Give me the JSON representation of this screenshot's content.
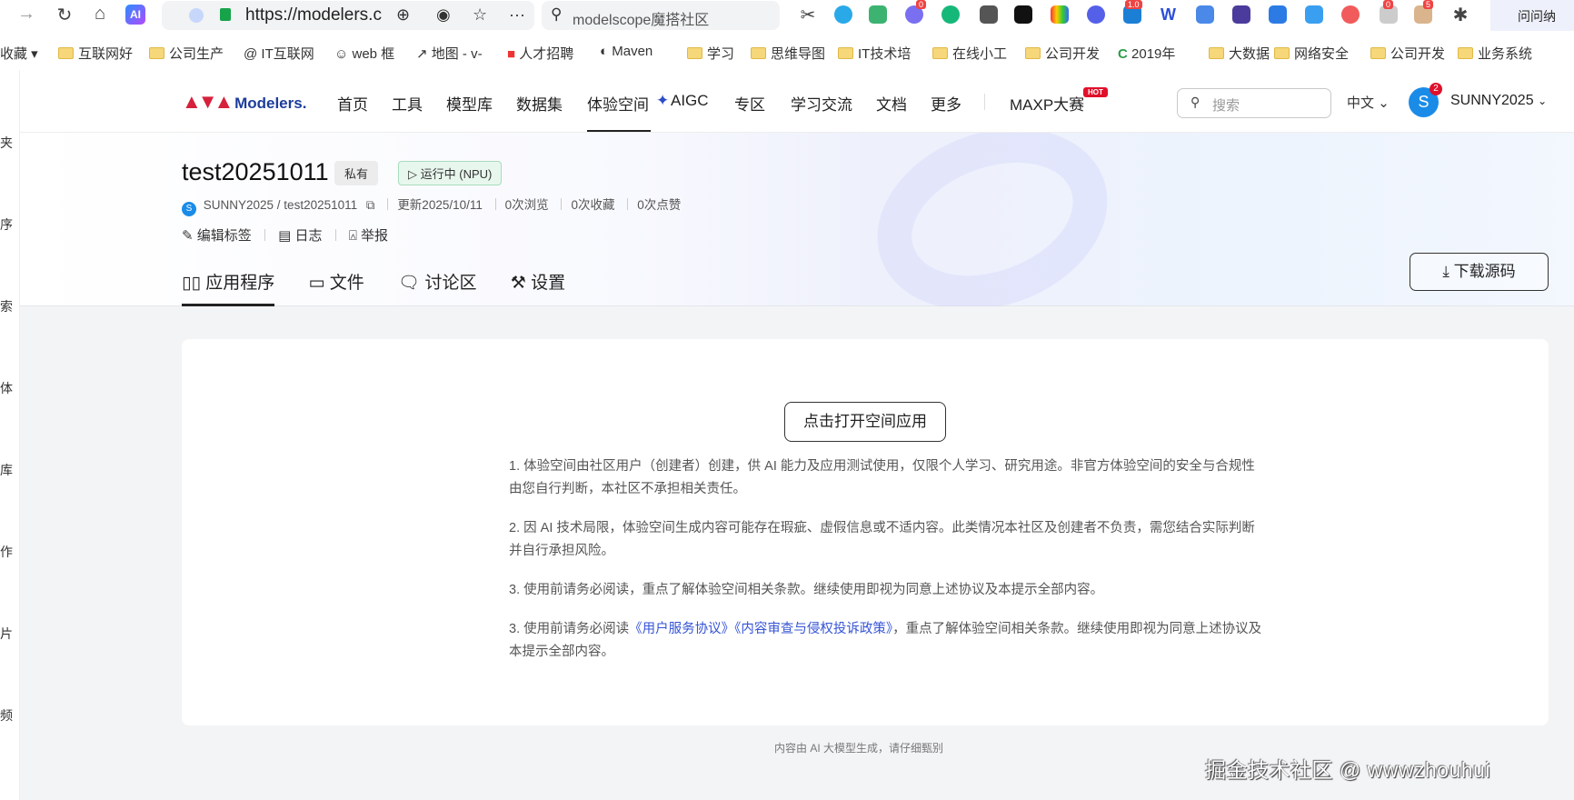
{
  "browser": {
    "url": "https://modelers.c",
    "search_text": "modelscope魔搭社区",
    "ai_label": "AI",
    "ext_badges": [
      "0",
      "1.0",
      "0",
      "5"
    ],
    "right_ext_label": "问问纳",
    "bookmarks": [
      "收藏",
      "互联网好",
      "公司生产",
      "IT互联网",
      "web 框",
      "地图 - v-",
      "人才招聘",
      "Maven",
      "学习",
      "思维导图",
      "IT技术培",
      "在线小工",
      "公司开发",
      "2019年",
      "大数据",
      "网络安全",
      "公司开发",
      "业务系统"
    ]
  },
  "left_strip": [
    "夹",
    "序",
    "索",
    "体",
    "库",
    "作",
    "片",
    "频"
  ],
  "header": {
    "logo": "Modelers.",
    "nav": [
      "首页",
      "工具",
      "模型库",
      "数据集",
      "体验空间",
      "AIGC",
      "专区",
      "学习交流",
      "文档",
      "更多",
      "MAXP大赛"
    ],
    "hot_badge": "HOT",
    "search_placeholder": "搜索",
    "language": "中文",
    "avatar_letter": "S",
    "notification_count": "2",
    "username": "SUNNY2025"
  },
  "space": {
    "title": "test20251011",
    "visibility": "私有",
    "status": "运行中 (NPU)",
    "owner_avatar": "S",
    "path": "SUNNY2025 / test20251011",
    "updated": "更新2025/10/11",
    "views": "0次浏览",
    "favorites": "0次收藏",
    "likes": "0次点赞",
    "actions": [
      "编辑标签",
      "日志",
      "举报"
    ],
    "tabs": [
      "应用程序",
      "文件",
      "讨论区",
      "设置"
    ],
    "active_tab": "应用程序",
    "download_label": "下载源码"
  },
  "content": {
    "open_button": "点击打开空间应用",
    "p1": "1. 体验空间由社区用户（创建者）创建，供 AI 能力及应用测试使用，仅限个人学习、研究用途。非官方体验空间的安全与合规性由您自行判断，本社区不承担相关责任。",
    "p2": "2. 因 AI 技术局限，体验空间生成内容可能存在瑕疵、虚假信息或不适内容。此类情况本社区及创建者不负责，需您结合实际判断并自行承担风险。",
    "p3": "3. 使用前请务必阅读，重点了解体验空间相关条款。继续使用即视为同意上述协议及本提示全部内容。",
    "p4_prefix": "3. 使用前请务必阅读",
    "p4_link1": "《用户服务协议》",
    "p4_link2": "《内容审查与侵权投诉政策》",
    "p4_suffix": "，重点了解体验空间相关条款。继续使用即视为同意上述协议及本提示全部内容。",
    "footer_note": "内容由 AI 大模型生成，请仔细甄别"
  },
  "watermark": "掘金技术社区 @ wwwzhouhui"
}
